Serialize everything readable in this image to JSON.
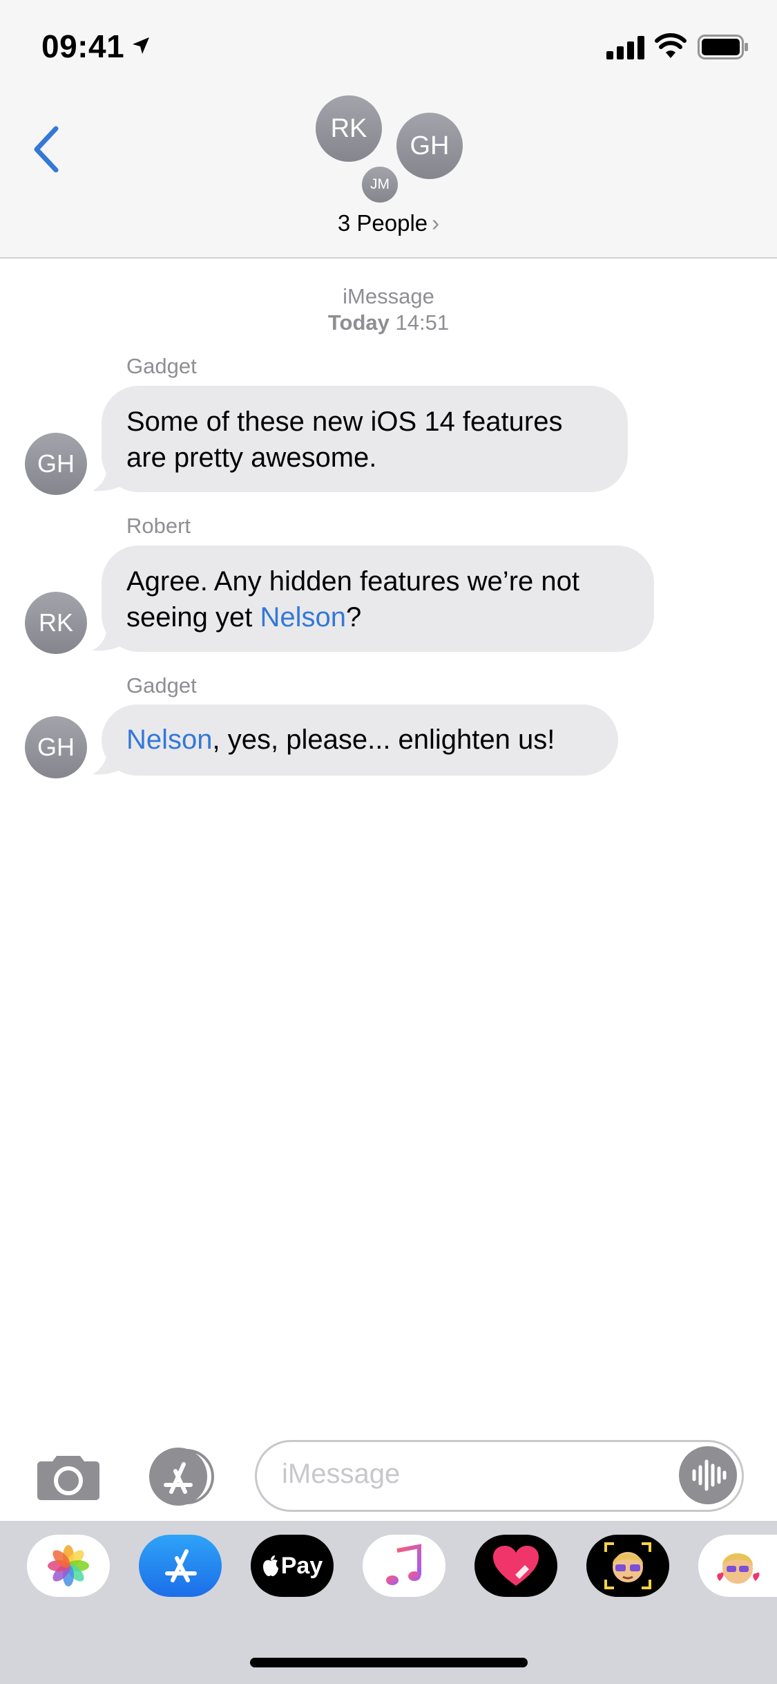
{
  "status_bar": {
    "time": "09:41"
  },
  "header": {
    "avatars": {
      "rk": "RK",
      "gh": "GH",
      "jm": "JM"
    },
    "title": "3 People",
    "chevron": "›"
  },
  "thread": {
    "service": "iMessage",
    "day": "Today",
    "time": "14:51",
    "messages": [
      {
        "sender": "Gadget",
        "initials": "GH",
        "lines": [
          "Some of these new iOS 14 features",
          "are pretty awesome."
        ]
      },
      {
        "sender": "Robert",
        "initials": "RK",
        "line1": "Agree. Any hidden features we’re not",
        "line2_prefix": "seeing yet ",
        "mention": "Nelson",
        "line2_suffix": "?"
      },
      {
        "sender": "Gadget",
        "initials": "GH",
        "mention": "Nelson",
        "suffix": ", yes, please... enlighten us!"
      }
    ]
  },
  "composer": {
    "placeholder": "iMessage"
  },
  "app_drawer": {
    "apps": [
      "photos-icon",
      "app-store-icon",
      "apple-pay-icon",
      "music-icon",
      "digital-touch-icon",
      "memoji-icon",
      "memoji-stickers-icon"
    ],
    "apple_pay_label": "Pay"
  },
  "colors": {
    "accent": "#3478d8",
    "bubble": "#e9e9eb",
    "avatar": "#8e8e93"
  }
}
